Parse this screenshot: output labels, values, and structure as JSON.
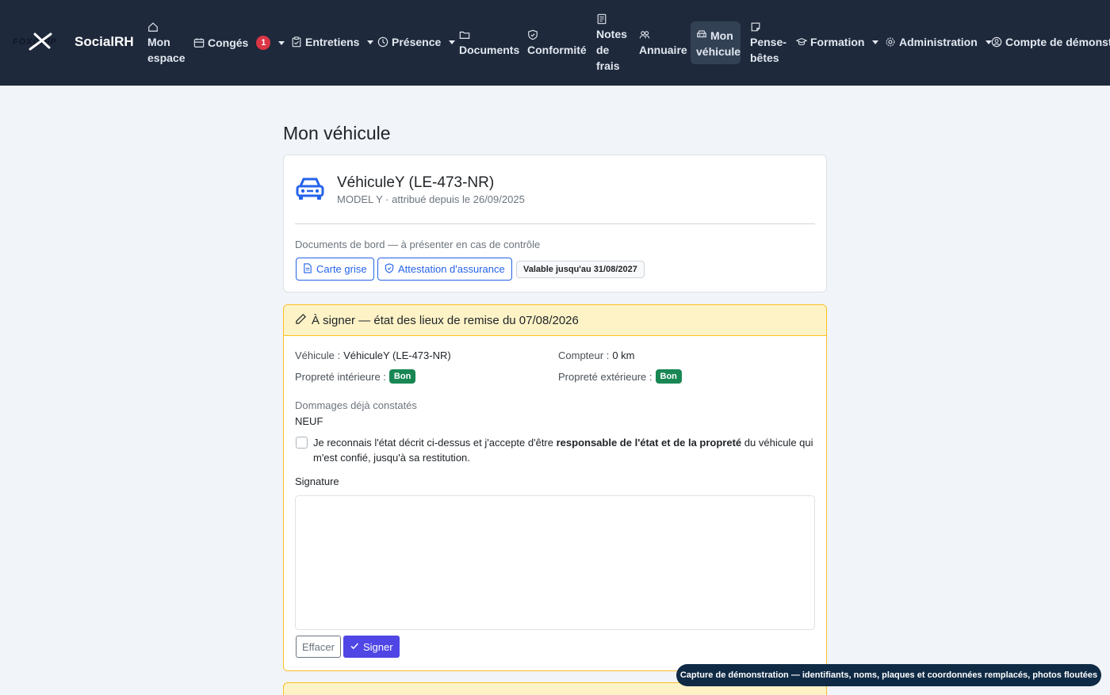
{
  "brand": {
    "logo_text": "FOXCHIP",
    "name": "SocialRH"
  },
  "nav": {
    "mon_espace": [
      "Mon",
      "espace"
    ],
    "conges": "Congés",
    "conges_count": "1",
    "entretiens": "Entretiens",
    "presence": "Présence",
    "documents": "Documents",
    "conformite": "Conformité",
    "notes_de_frais": [
      "Notes",
      "de",
      "frais"
    ],
    "annuaire": "Annuaire",
    "mon_vehicule": [
      "Mon",
      "véhicule"
    ],
    "pense_betes": [
      "Pense-",
      "bêtes"
    ],
    "formation": "Formation",
    "administration": "Administration",
    "compte": "Compte de démonstra"
  },
  "page": {
    "title": "Mon véhicule"
  },
  "vehicle": {
    "name": "VéhiculeY (LE-473-NR)",
    "subtitle": "MODEL Y · attribué depuis le 26/09/2025",
    "docs_label": "Documents de bord — à présenter en cas de contrôle",
    "carte_grise": "Carte grise",
    "attestation": "Attestation d'assurance",
    "validity": "Valable jusqu'au 31/08/2027"
  },
  "signature_card": {
    "header": "À signer — état des lieux de remise du 07/08/2026",
    "vehicle_label": "Véhicule :",
    "vehicle_value": "VéhiculeY (LE-473-NR)",
    "counter_label": "Compteur :",
    "counter_value": "0 km",
    "interior_label": "Propreté intérieure :",
    "interior_value": "Bon",
    "exterior_label": "Propreté extérieure :",
    "exterior_value": "Bon",
    "damage_label": "Dommages déjà constatés",
    "damage_value": "NEUF",
    "ack_before": "Je reconnais l'état décrit ci-dessus et j'accepte d'être ",
    "ack_bold": "responsable de l'état et de la propreté",
    "ack_after": " du véhicule qui m'est confié, jusqu'à sa restitution.",
    "signature_label": "Signature",
    "clear_button": "Effacer",
    "sign_button": "Signer"
  },
  "toast": "Capture de démonstration — identifiants, noms, plaques et coordonnées remplacés, photos floutées",
  "colors": {
    "navbar": "#1e293b",
    "primary": "#2563eb",
    "success": "#198754",
    "warning_bg": "#fdf3c7",
    "sign_button": "#4f46e5"
  }
}
